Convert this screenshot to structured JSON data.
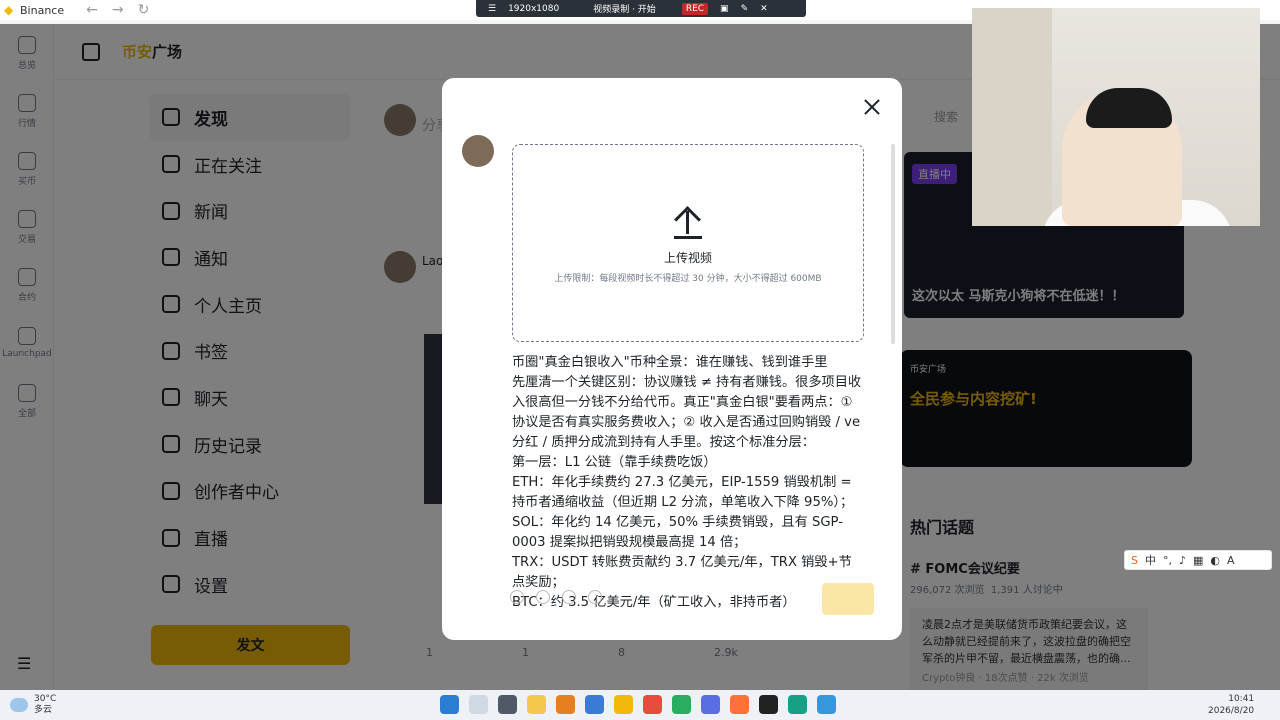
{
  "window": {
    "title": "Binance"
  },
  "recorder": {
    "resolution": "1920x1080",
    "status": "视频录制 · 开始",
    "rec": "REC"
  },
  "left_nav": [
    {
      "label": "总览"
    },
    {
      "label": "行情"
    },
    {
      "label": "买币"
    },
    {
      "label": "交易"
    },
    {
      "label": "合约"
    },
    {
      "label": "Launchpad"
    },
    {
      "label": "全部"
    }
  ],
  "header": {
    "brand_prefix": "币安",
    "brand_suffix": "广场"
  },
  "menu": [
    {
      "label": "发现",
      "icon": "discover-icon",
      "active": true
    },
    {
      "label": "正在关注",
      "icon": "following-icon"
    },
    {
      "label": "新闻",
      "icon": "news-icon"
    },
    {
      "label": "通知",
      "icon": "bell-icon"
    },
    {
      "label": "个人主页",
      "icon": "profile-icon"
    },
    {
      "label": "书签",
      "icon": "bookmark-icon"
    },
    {
      "label": "聊天",
      "icon": "chat-icon"
    },
    {
      "label": "历史记录",
      "icon": "history-icon"
    },
    {
      "label": "创作者中心",
      "icon": "creator-icon"
    },
    {
      "label": "直播",
      "icon": "live-icon"
    },
    {
      "label": "设置",
      "icon": "settings-icon"
    }
  ],
  "post_button": "发文",
  "feed": {
    "compose_placeholder": "分享",
    "author": "Lao",
    "stats": {
      "replies": "1",
      "reposts": "1",
      "likes": "8",
      "views": "2.9k"
    }
  },
  "right": {
    "search_placeholder": "搜索",
    "banner1": {
      "badge": "直播中",
      "caption": "这次以太 马斯克小狗将不在低迷！！"
    },
    "banner2": {
      "brand": "币安广场",
      "headline": "全民参与内容挖矿!"
    },
    "hot_topics": {
      "title": "热门话题",
      "tag": "FOMC会议纪要",
      "views": "296,072 次浏览",
      "discussing": "1,391 人讨论中",
      "snippet": "凌晨2点才是美联储货币政策纪要会议，这么动静就已经提前来了，这波拉盘的确把空军杀的片甲不留，最近横盘震荡，也的确...",
      "meta": "Crypto钟良 · 18次点赞 · 22k 次浏览"
    }
  },
  "modal": {
    "upload_title": "上传视频",
    "upload_hint": "上传限制：每段视频时长不得超过 30 分钟，大小不得超过 600MB",
    "body": "币圈\"真金白银收入\"币种全景：谁在赚钱、钱到谁手里\n先厘清一个关键区别：协议赚钱 ≠ 持有者赚钱。很多项目收入很高但一分钱不分给代币。真正\"真金白银\"要看两点：① 协议是否有真实服务费收入；② 收入是否通过回购销毁 / ve分红 / 质押分成流到持有人手里。按这个标准分层：\n第一层：L1 公链（靠手续费吃饭）\nETH：年化手续费约 27.3 亿美元，EIP-1559 销毁机制 = 持币者通缩收益（但近期 L2 分流，单笔收入下降 95%）；\nSOL：年化约 14 亿美元，50% 手续费销毁，且有 SGP-0003 提案拟把销毁规模最高提 14 倍；\nTRX：USDT 转账费贡献约 3.7 亿美元/年，TRX 销毁+节点奖励；\nBTC：约 3.5 亿美元/年（矿工收入，非持币者）"
  },
  "ime": {
    "lang": "中"
  },
  "taskbar": {
    "temp": "30°C",
    "weather": "多云",
    "time": "10:41",
    "date": "2026/8/20"
  }
}
